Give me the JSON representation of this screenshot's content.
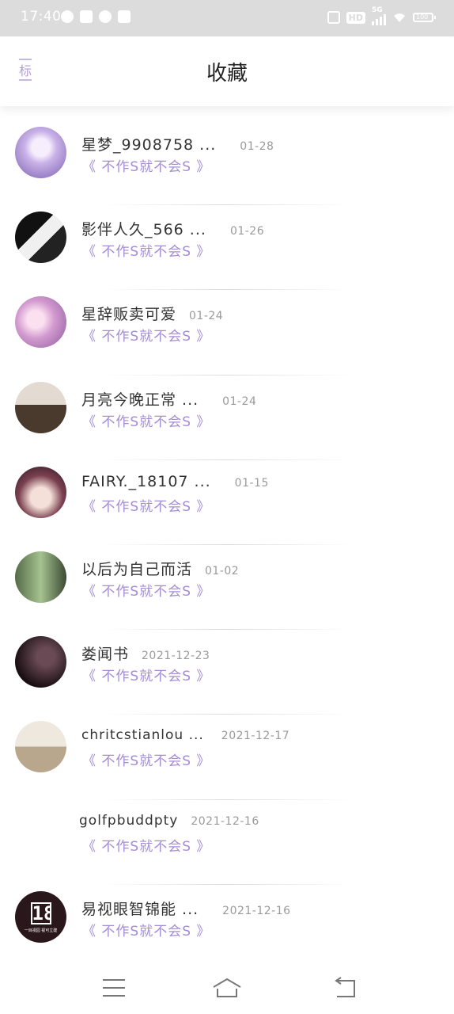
{
  "status_bar": {
    "time": "17:40",
    "left_icons": [
      "messenger-icon",
      "mail-icon",
      "chat-icon",
      "pinwheel-icon"
    ],
    "right_icons": [
      "vibrate-icon",
      "hd-icon",
      "signal-5g-icon",
      "wifi-icon",
      "battery-icon"
    ],
    "hd_label": "HD",
    "network_label": "5G",
    "battery_label": "100"
  },
  "header": {
    "tab_label": "标",
    "title": "收藏"
  },
  "list": {
    "items": [
      {
        "name": "星梦_9908758 ...",
        "date": "01-28",
        "subtitle": "《 不作S就不会S 》",
        "avatar_colors": [
          "#d9c6ee",
          "#7b5fb0"
        ]
      },
      {
        "name": "影伴人久_566 ...",
        "date": "01-26",
        "subtitle": "《 不作S就不会S 》",
        "avatar_colors": [
          "#f5f5f5",
          "#111111"
        ]
      },
      {
        "name": "星辞贩卖可爱",
        "date": "01-24",
        "subtitle": "《 不作S就不会S 》",
        "avatar_colors": [
          "#f3d0e8",
          "#8a5a9a"
        ]
      },
      {
        "name": "月亮今晚正常 ...",
        "date": "01-24",
        "subtitle": "《 不作S就不会S 》",
        "avatar_colors": [
          "#d8cfc6",
          "#3b3028"
        ]
      },
      {
        "name": "FAIRY._18107 ...",
        "date": "01-15",
        "subtitle": "《 不作S就不会S 》",
        "avatar_colors": [
          "#f0dcd6",
          "#4a2b3a"
        ]
      },
      {
        "name": "以后为自己而活",
        "date": "01-02",
        "subtitle": "《 不作S就不会S 》",
        "avatar_colors": [
          "#9bb58a",
          "#3c4a36"
        ]
      },
      {
        "name": "娄闻书",
        "date": "2021-12-23",
        "subtitle": "《 不作S就不会S 》",
        "avatar_colors": [
          "#3a2a30",
          "#0e0a0c"
        ]
      },
      {
        "name": "chritcstianlou ...",
        "date": "2021-12-17",
        "subtitle": "《 不作S就不会S 》",
        "avatar_colors": [
          "#e6ddd0",
          "#9a8a72"
        ]
      },
      {
        "name": "golfpbuddpty",
        "date": "2021-12-16",
        "subtitle": "《 不作S就不会S 》",
        "avatar_colors": []
      },
      {
        "name": "易视眼智锦能 ...",
        "date": "2021-12-16",
        "subtitle": "《 不作S就不会S 》",
        "avatar_colors": [
          "#3a2327",
          "#1a0f12"
        ],
        "avatar_text": "18",
        "avatar_caption": "一目视园 视可立建"
      }
    ]
  },
  "nav_bar": {
    "icons": [
      "menu-icon",
      "home-icon",
      "back-icon"
    ]
  },
  "colors": {
    "accent": "#a58bd6",
    "status_bar": "#dcdcdc",
    "date_text": "#9a9a9a"
  }
}
